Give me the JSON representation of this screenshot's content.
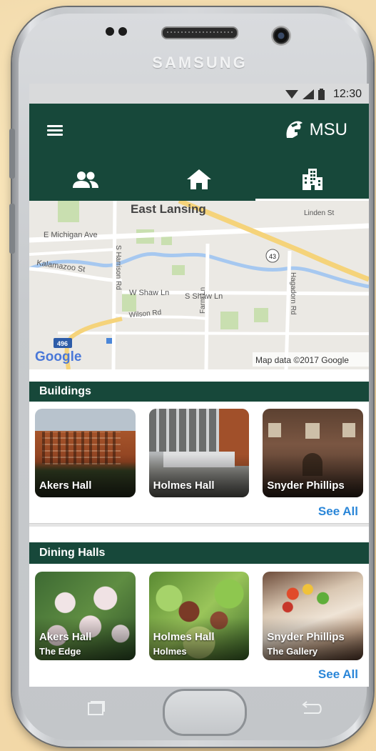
{
  "device": {
    "brand": "SAMSUNG"
  },
  "status_bar": {
    "time": "12:30",
    "icons": [
      "wifi-icon",
      "signal-icon",
      "battery-icon"
    ]
  },
  "app_bar": {
    "menu_icon": "hamburger-menu-icon",
    "logo_icon": "spartan-helmet-icon",
    "title": "MSU"
  },
  "tabs": [
    {
      "icon": "people-icon",
      "active": false
    },
    {
      "icon": "home-icon",
      "active": false
    },
    {
      "icon": "buildings-icon",
      "active": true
    }
  ],
  "map": {
    "labels": {
      "city": "East Lansing",
      "linden": "Linden St",
      "michigan": "E Michigan Ave",
      "kalamazoo": "Kalamazoo St",
      "harrison": "S Harrison Rd",
      "wshaw": "W Shaw Ln",
      "sshaw": "S Shaw Ln",
      "wilson": "Wilson Rd",
      "farm": "Farm Ln",
      "hagadorn": "Hagadorn Rd",
      "route43": "43",
      "i496": "496"
    },
    "google_logo": "Google",
    "attribution": "Map data ©2017 Google"
  },
  "buildings": {
    "header": "Buildings",
    "items": [
      {
        "name": "Akers Hall"
      },
      {
        "name": "Holmes Hall"
      },
      {
        "name": "Snyder Phillips"
      }
    ],
    "see_all": "See All"
  },
  "dining": {
    "header": "Dining Halls",
    "items": [
      {
        "name": "Akers Hall",
        "sub": "The Edge"
      },
      {
        "name": "Holmes Hall",
        "sub": "Holmes"
      },
      {
        "name": "Snyder Phillips",
        "sub": "The Gallery"
      }
    ],
    "see_all": "See All"
  },
  "colors": {
    "primary": "#17483a",
    "link": "#2a86d8",
    "background": "#f3dcae"
  }
}
